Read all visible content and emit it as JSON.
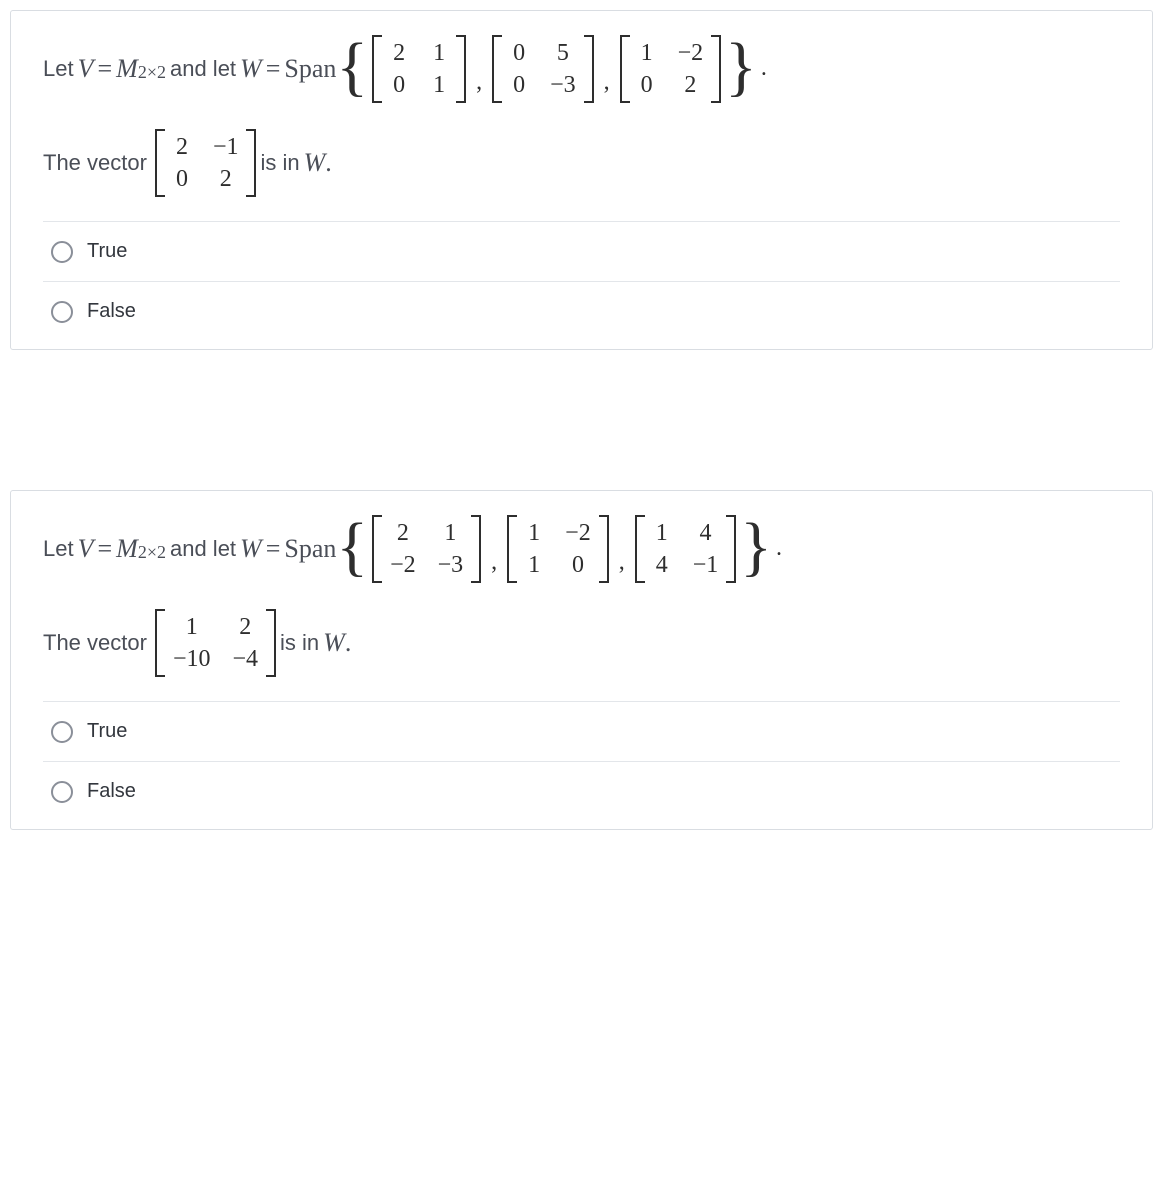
{
  "q1": {
    "line1": {
      "t1": "Let ",
      "V": "V",
      "eq1": " = ",
      "M": "M",
      "Msub": "2×2",
      "t2": " and let ",
      "W": "W",
      "eq2": " = ",
      "Span": "Span",
      "m1": [
        "2",
        "1",
        "0",
        "1"
      ],
      "m2": [
        "0",
        "5",
        "0",
        "−3"
      ],
      "m3": [
        "1",
        "−2",
        "0",
        "2"
      ]
    },
    "line2": {
      "t1": "The vector ",
      "m": [
        "2",
        "−1",
        "0",
        "2"
      ],
      "t2": " is in ",
      "W": "W",
      "t3": "."
    },
    "opts": {
      "a": "True",
      "b": "False"
    }
  },
  "q2": {
    "line1": {
      "t1": "Let ",
      "V": "V",
      "eq1": " = ",
      "M": "M",
      "Msub": "2×2",
      "t2": " and let ",
      "W": "W",
      "eq2": " = ",
      "Span": "Span",
      "m1": [
        "2",
        "1",
        "−2",
        "−3"
      ],
      "m2": [
        "1",
        "−2",
        "1",
        "0"
      ],
      "m3": [
        "1",
        "4",
        "4",
        "−1"
      ]
    },
    "line2": {
      "t1": "The vector ",
      "m": [
        "1",
        "2",
        "−10",
        "−4"
      ],
      "t2": " is in ",
      "W": "W",
      "t3": "."
    },
    "opts": {
      "a": "True",
      "b": "False"
    }
  }
}
